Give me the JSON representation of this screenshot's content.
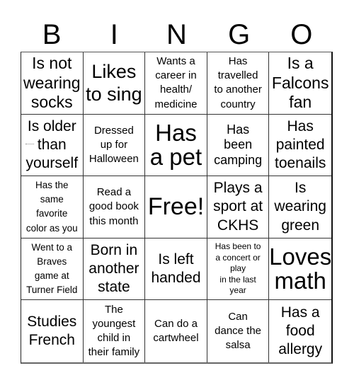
{
  "header": {
    "letters": [
      "B",
      "I",
      "N",
      "G",
      "O"
    ]
  },
  "card": {
    "rows": [
      [
        {
          "text": "Is not\nwearing\nsocks",
          "size": "l"
        },
        {
          "text": "Likes\nto sing",
          "size": "l2"
        },
        {
          "text": "Wants a\ncareer in\nhealth/\nmedicine",
          "size": "s"
        },
        {
          "text": "Has\ntravelled\nto another\ncountry",
          "size": "s"
        },
        {
          "text": "Is a\nFalcons\nfan",
          "size": "l"
        }
      ],
      [
        {
          "text": "Is older\nthan\nyourself",
          "size": "m"
        },
        {
          "text": "Dressed\nup for\nHalloween",
          "size": "s"
        },
        {
          "text": "Has\na pet",
          "size": "xl"
        },
        {
          "text": "Has\nbeen\ncamping",
          "size": "ms"
        },
        {
          "text": "Has\npainted\ntoenails",
          "size": "m"
        }
      ],
      [
        {
          "text": "Has the\nsame\nfavorite\ncolor as you",
          "size": "xs"
        },
        {
          "text": "Read a\ngood book\nthis month",
          "size": "s"
        },
        {
          "text": "Free!",
          "size": "free"
        },
        {
          "text": "Plays a\nsport at\nCKHS",
          "size": "m"
        },
        {
          "text": "Is\nwearing\ngreen",
          "size": "m"
        }
      ],
      [
        {
          "text": "Went to a\nBraves\ngame at\nTurner Field",
          "size": "xs"
        },
        {
          "text": "Born in\nanother\nstate",
          "size": "m"
        },
        {
          "text": "Is left\nhanded",
          "size": "m"
        },
        {
          "text": "Has been to\na concert or\nplay\nin the last\nyear",
          "size": "tiny"
        },
        {
          "text": "Loves\nmath",
          "size": "xl"
        }
      ],
      [
        {
          "text": "Studies\nFrench",
          "size": "m"
        },
        {
          "text": "The\nyoungest\nchild in\ntheir family",
          "size": "s"
        },
        {
          "text": "Can do a\ncartwheel",
          "size": "s"
        },
        {
          "text": "Can\ndance the\nsalsa",
          "size": "s"
        },
        {
          "text": "Has a\nfood\nallergy",
          "size": "m"
        }
      ]
    ]
  }
}
